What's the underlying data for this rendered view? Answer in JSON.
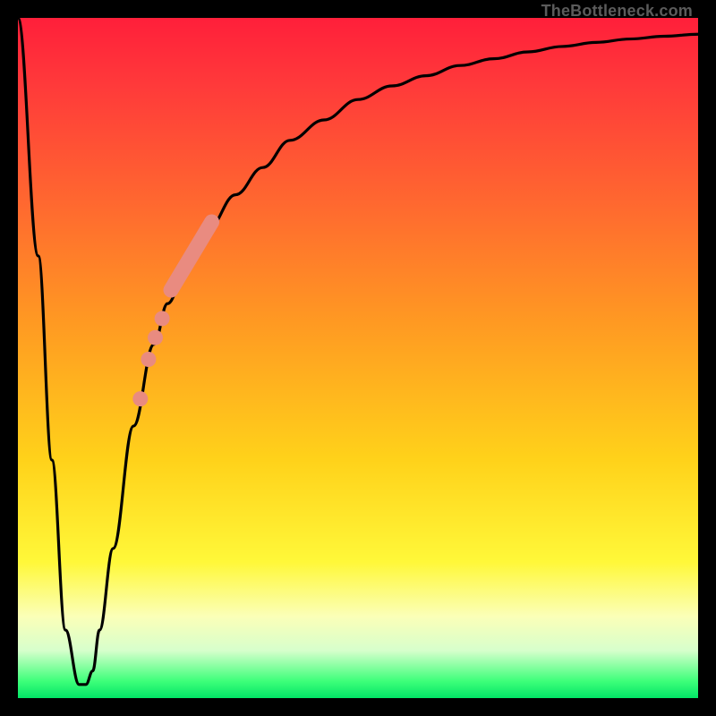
{
  "attribution": "TheBottleneck.com",
  "colors": {
    "frame": "#000000",
    "curve": "#000000",
    "marker": "#e98b80",
    "gradient_top": "#ff1f3a",
    "gradient_bottom": "#02e566"
  },
  "chart_data": {
    "type": "line",
    "title": "",
    "xlabel": "",
    "ylabel": "",
    "xlim": [
      0,
      100
    ],
    "ylim": [
      0,
      100
    ],
    "grid": false,
    "legend": false,
    "series": [
      {
        "name": "bottleneck-curve",
        "x": [
          0,
          3,
          5,
          7,
          9,
          10,
          11,
          12,
          14,
          17,
          20,
          22,
          25,
          28,
          32,
          36,
          40,
          45,
          50,
          55,
          60,
          65,
          70,
          75,
          80,
          85,
          90,
          95,
          100
        ],
        "y": [
          100,
          65,
          35,
          10,
          2,
          2,
          4,
          10,
          22,
          40,
          52,
          58,
          64,
          69,
          74,
          78,
          82,
          85,
          88,
          90,
          91.5,
          93,
          94,
          95,
          95.8,
          96.4,
          96.9,
          97.3,
          97.6
        ]
      }
    ],
    "markers": {
      "name": "highlight-segment",
      "color": "#e98b80",
      "thick_segment": {
        "x": [
          22.5,
          28.5
        ],
        "y": [
          60,
          70
        ]
      },
      "dots": [
        {
          "x": 21.2,
          "y": 55.8
        },
        {
          "x": 20.2,
          "y": 53.0
        },
        {
          "x": 19.2,
          "y": 49.8
        },
        {
          "x": 18.0,
          "y": 44.0
        }
      ]
    },
    "annotations": []
  }
}
